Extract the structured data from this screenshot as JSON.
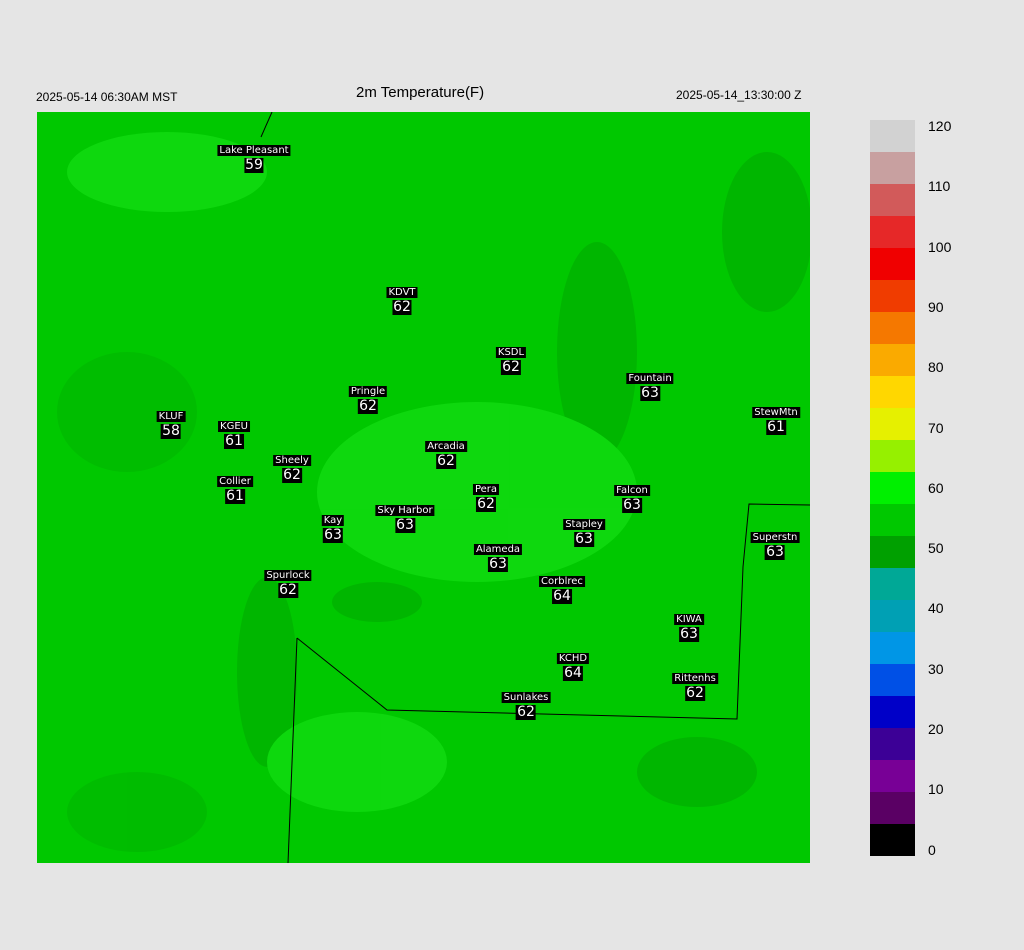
{
  "header": {
    "local_time": "2025-05-14 06:30AM MST",
    "title": "2m Temperature(F)",
    "utc_time": "2025-05-14_13:30:00 Z"
  },
  "map": {
    "field_color": "#00c800",
    "highlight_color": "#19e619",
    "shade_color": "#00a800",
    "boundary_color": "#000000"
  },
  "stations": [
    {
      "name": "Lake Pleasant",
      "value": "59"
    },
    {
      "name": "KDVT",
      "value": "62"
    },
    {
      "name": "KSDL",
      "value": "62"
    },
    {
      "name": "Fountain",
      "value": "63"
    },
    {
      "name": "StewMtn",
      "value": "61"
    },
    {
      "name": "Pringle",
      "value": "62"
    },
    {
      "name": "KLUF",
      "value": "58"
    },
    {
      "name": "KGEU",
      "value": "61"
    },
    {
      "name": "Arcadia",
      "value": "62"
    },
    {
      "name": "Sheely",
      "value": "62"
    },
    {
      "name": "Collier",
      "value": "61"
    },
    {
      "name": "Pera",
      "value": "62"
    },
    {
      "name": "Falcon",
      "value": "63"
    },
    {
      "name": "Kay",
      "value": "63"
    },
    {
      "name": "Sky Harbor",
      "value": "63"
    },
    {
      "name": "Stapley",
      "value": "63"
    },
    {
      "name": "Superstn",
      "value": "63"
    },
    {
      "name": "Alameda",
      "value": "63"
    },
    {
      "name": "Spurlock",
      "value": "62"
    },
    {
      "name": "Corblrec",
      "value": "64"
    },
    {
      "name": "KIWA",
      "value": "63"
    },
    {
      "name": "KCHD",
      "value": "64"
    },
    {
      "name": "Rittenhs",
      "value": "62"
    },
    {
      "name": "Sunlakes",
      "value": "62"
    }
  ],
  "colorbar": {
    "ticks": [
      "120",
      "110",
      "100",
      "90",
      "80",
      "70",
      "60",
      "50",
      "40",
      "30",
      "20",
      "10",
      "0"
    ],
    "colors": [
      "#d2d2d2",
      "#c8a0a0",
      "#d25a5a",
      "#e62828",
      "#f00000",
      "#f03c00",
      "#f57800",
      "#faaa00",
      "#ffd700",
      "#e6f000",
      "#96f000",
      "#00f000",
      "#00c800",
      "#00a000",
      "#00a896",
      "#00a0b4",
      "#0096e6",
      "#0050e6",
      "#0000c8",
      "#3c0096",
      "#780096",
      "#5a0064",
      "#000000"
    ]
  }
}
